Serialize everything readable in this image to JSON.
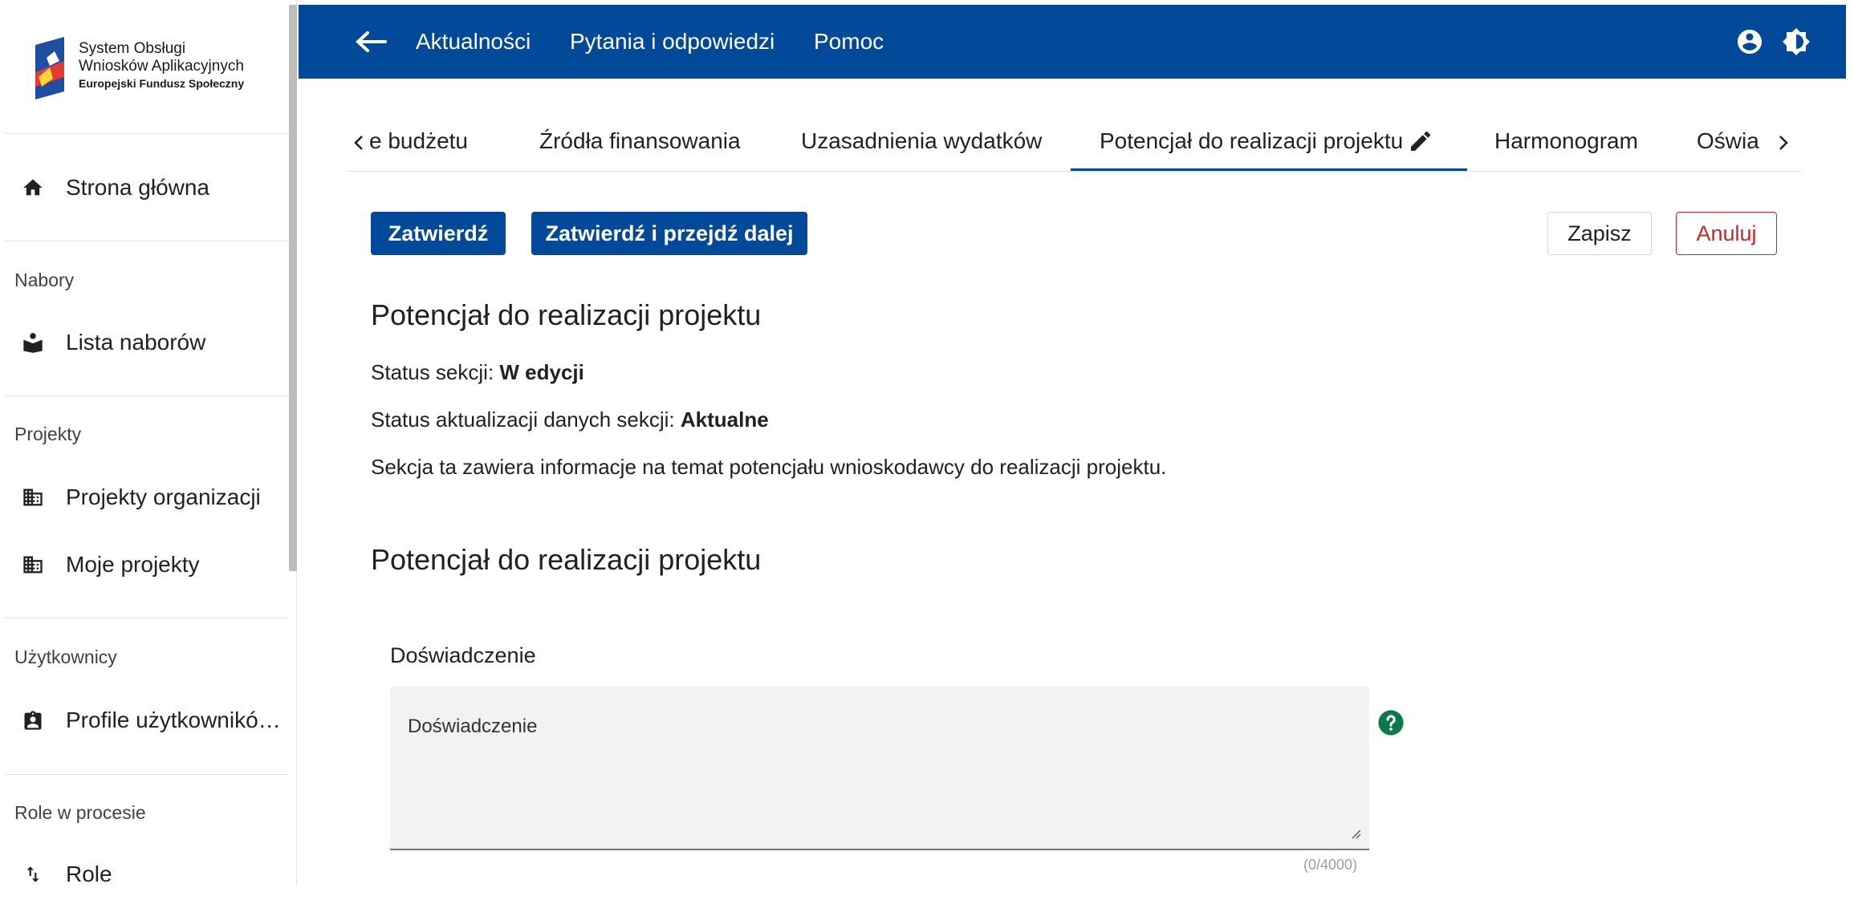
{
  "app": {
    "logo_line1": "System Obsługi",
    "logo_line2": "Wniosków Aplikacyjnych",
    "logo_line3": "Europejski Fundusz Społeczny"
  },
  "sidebar": {
    "home_label": "Strona główna",
    "sections": [
      {
        "title": "Nabory",
        "items": [
          {
            "label": "Lista naborów",
            "icon": "book-reader-icon"
          }
        ]
      },
      {
        "title": "Projekty",
        "items": [
          {
            "label": "Projekty organizacji",
            "icon": "building-icon"
          },
          {
            "label": "Moje projekty",
            "icon": "building-icon"
          }
        ]
      },
      {
        "title": "Użytkownicy",
        "items": [
          {
            "label": "Profile użytkownikó…",
            "icon": "badge-icon"
          }
        ]
      },
      {
        "title": "Role w procesie",
        "items": [
          {
            "label": "Role",
            "icon": "swap-vert-icon"
          }
        ]
      }
    ]
  },
  "topbar": {
    "links": [
      "Aktualności",
      "Pytania i odpowiedzi",
      "Pomoc"
    ],
    "color": "#024a99"
  },
  "tabs": {
    "items": [
      "e budżetu",
      "Źródła finansowania",
      "Uzasadnienia wydatków",
      "Potencjał do realizacji projektu",
      "Harmonogram",
      "Oświa"
    ],
    "active_index": 3
  },
  "actions": {
    "confirm": "Zatwierdź",
    "confirm_next": "Zatwierdź i przejdź dalej",
    "save": "Zapisz",
    "cancel": "Anuluj"
  },
  "section": {
    "title": "Potencjał do realizacji projektu",
    "status_label": "Status sekcji:",
    "status_value": "W edycji",
    "update_label": "Status aktualizacji danych sekcji:",
    "update_value": "Aktualne",
    "description": "Sekcja ta zawiera informacje na temat potencjału wnioskodawcy do realizacji projektu.",
    "subtitle": "Potencjał do realizacji projektu"
  },
  "form": {
    "field_label": "Doświadczenie",
    "placeholder": "Doświadczenie",
    "counter": "(0/4000)"
  }
}
